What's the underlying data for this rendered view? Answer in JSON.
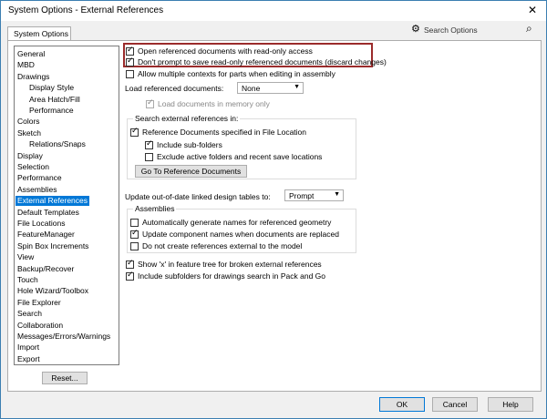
{
  "window": {
    "title": "System Options - External References",
    "close_glyph": "✕"
  },
  "tab": {
    "label": "System Options"
  },
  "search": {
    "placeholder": "Search Options"
  },
  "tree": {
    "items": [
      {
        "label": "General",
        "child": false
      },
      {
        "label": "MBD",
        "child": false
      },
      {
        "label": "Drawings",
        "child": false
      },
      {
        "label": "Display Style",
        "child": true
      },
      {
        "label": "Area Hatch/Fill",
        "child": true
      },
      {
        "label": "Performance",
        "child": true
      },
      {
        "label": "Colors",
        "child": false
      },
      {
        "label": "Sketch",
        "child": false
      },
      {
        "label": "Relations/Snaps",
        "child": true
      },
      {
        "label": "Display",
        "child": false
      },
      {
        "label": "Selection",
        "child": false
      },
      {
        "label": "Performance",
        "child": false
      },
      {
        "label": "Assemblies",
        "child": false
      },
      {
        "label": "External References",
        "child": false,
        "selected": true
      },
      {
        "label": "Default Templates",
        "child": false
      },
      {
        "label": "File Locations",
        "child": false
      },
      {
        "label": "FeatureManager",
        "child": false
      },
      {
        "label": "Spin Box Increments",
        "child": false
      },
      {
        "label": "View",
        "child": false
      },
      {
        "label": "Backup/Recover",
        "child": false
      },
      {
        "label": "Touch",
        "child": false
      },
      {
        "label": "Hole Wizard/Toolbox",
        "child": false
      },
      {
        "label": "File Explorer",
        "child": false
      },
      {
        "label": "Search",
        "child": false
      },
      {
        "label": "Collaboration",
        "child": false
      },
      {
        "label": "Messages/Errors/Warnings",
        "child": false
      },
      {
        "label": "Import",
        "child": false
      },
      {
        "label": "Export",
        "child": false
      }
    ],
    "reset_label": "Reset..."
  },
  "options": {
    "open_readonly": {
      "label": "Open referenced documents with read-only access",
      "checked": true
    },
    "dont_prompt": {
      "label": "Don't prompt to save read-only referenced documents (discard changes)",
      "checked": true
    },
    "allow_multiple": {
      "label": "Allow multiple contexts for parts when editing in assembly",
      "checked": false
    },
    "load_ref_label": "Load referenced documents:",
    "load_ref_value": "None",
    "load_in_memory": {
      "label": "Load documents in memory only",
      "checked": true
    },
    "search_group_title": "Search external references in:",
    "ref_docs_file_loc": {
      "label": "Reference Documents specified in File Location",
      "checked": true
    },
    "include_subfolders": {
      "label": "Include sub-folders",
      "checked": true
    },
    "exclude_active": {
      "label": "Exclude active folders and recent save locations",
      "checked": false
    },
    "goto_ref_docs_button": "Go To Reference Documents",
    "update_tables_label": "Update out-of-date linked design tables to:",
    "update_tables_value": "Prompt",
    "assemblies_group_title": "Assemblies",
    "auto_names": {
      "label": "Automatically generate names for referenced geometry",
      "checked": false
    },
    "update_component_names": {
      "label": "Update component names when documents are replaced",
      "checked": true
    },
    "no_external_refs": {
      "label": "Do not create references external to the model",
      "checked": false
    },
    "show_x": {
      "label": "Show 'x' in feature tree for broken external references",
      "checked": true
    },
    "include_subfolders_pack": {
      "label": "Include subfolders for drawings search in Pack and Go",
      "checked": true
    }
  },
  "buttons": {
    "ok": "OK",
    "cancel": "Cancel",
    "help": "Help"
  },
  "colors": {
    "highlight_border": "#9b2b2b",
    "selection": "#0078d7"
  }
}
